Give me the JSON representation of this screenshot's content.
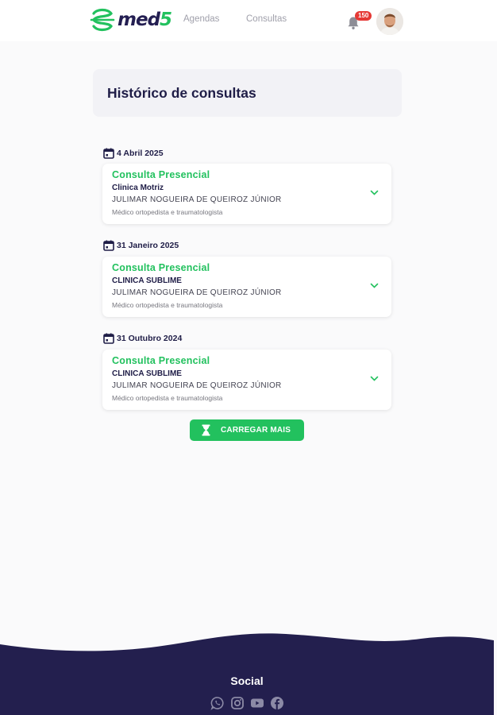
{
  "header": {
    "logo_text": "med",
    "logo_number": "5",
    "nav": [
      {
        "label": "Agendas"
      },
      {
        "label": "Consultas"
      }
    ],
    "notification_count": "150"
  },
  "page": {
    "title": "Histórico de consultas"
  },
  "appointments": [
    {
      "date": "4 Abril 2025",
      "type": "Consulta Presencial",
      "clinic": "Clinica Motriz",
      "doctor": "JULIMAR NOGUEIRA DE QUEIROZ JÚNIOR",
      "specialty": "Médico ortopedista e traumatologista"
    },
    {
      "date": "31 Janeiro 2025",
      "type": "Consulta Presencial",
      "clinic": "CLINICA SUBLIME",
      "doctor": "JULIMAR NOGUEIRA DE QUEIROZ JÚNIOR",
      "specialty": "Médico ortopedista e traumatologista"
    },
    {
      "date": "31 Outubro 2024",
      "type": "Consulta Presencial",
      "clinic": "CLINICA SUBLIME",
      "doctor": "JULIMAR NOGUEIRA DE QUEIROZ JÚNIOR",
      "specialty": "Médico ortopedista e traumatologista"
    }
  ],
  "load_more": {
    "label": "CARREGAR MAIS"
  },
  "footer": {
    "social_title": "Social",
    "social_icons": [
      "whatsapp-icon",
      "instagram-icon",
      "youtube-icon",
      "facebook-icon"
    ]
  },
  "colors": {
    "brand_green": "#22c15e",
    "brand_navy": "#241f52",
    "badge_red": "#e53935"
  }
}
